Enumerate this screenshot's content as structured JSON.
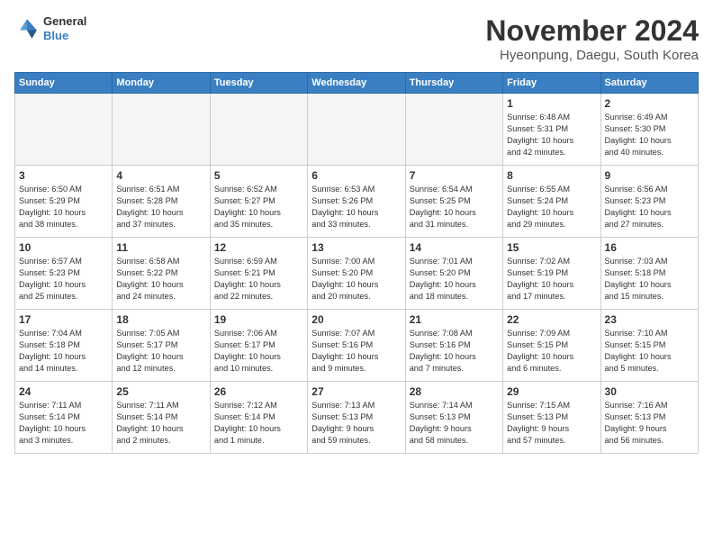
{
  "header": {
    "logo_line1": "General",
    "logo_line2": "Blue",
    "month_year": "November 2024",
    "location": "Hyeonpung, Daegu, South Korea"
  },
  "days_of_week": [
    "Sunday",
    "Monday",
    "Tuesday",
    "Wednesday",
    "Thursday",
    "Friday",
    "Saturday"
  ],
  "weeks": [
    [
      {
        "day": "",
        "info": "",
        "empty": true
      },
      {
        "day": "",
        "info": "",
        "empty": true
      },
      {
        "day": "",
        "info": "",
        "empty": true
      },
      {
        "day": "",
        "info": "",
        "empty": true
      },
      {
        "day": "",
        "info": "",
        "empty": true
      },
      {
        "day": "1",
        "info": "Sunrise: 6:48 AM\nSunset: 5:31 PM\nDaylight: 10 hours\nand 42 minutes."
      },
      {
        "day": "2",
        "info": "Sunrise: 6:49 AM\nSunset: 5:30 PM\nDaylight: 10 hours\nand 40 minutes."
      }
    ],
    [
      {
        "day": "3",
        "info": "Sunrise: 6:50 AM\nSunset: 5:29 PM\nDaylight: 10 hours\nand 38 minutes."
      },
      {
        "day": "4",
        "info": "Sunrise: 6:51 AM\nSunset: 5:28 PM\nDaylight: 10 hours\nand 37 minutes."
      },
      {
        "day": "5",
        "info": "Sunrise: 6:52 AM\nSunset: 5:27 PM\nDaylight: 10 hours\nand 35 minutes."
      },
      {
        "day": "6",
        "info": "Sunrise: 6:53 AM\nSunset: 5:26 PM\nDaylight: 10 hours\nand 33 minutes."
      },
      {
        "day": "7",
        "info": "Sunrise: 6:54 AM\nSunset: 5:25 PM\nDaylight: 10 hours\nand 31 minutes."
      },
      {
        "day": "8",
        "info": "Sunrise: 6:55 AM\nSunset: 5:24 PM\nDaylight: 10 hours\nand 29 minutes."
      },
      {
        "day": "9",
        "info": "Sunrise: 6:56 AM\nSunset: 5:23 PM\nDaylight: 10 hours\nand 27 minutes."
      }
    ],
    [
      {
        "day": "10",
        "info": "Sunrise: 6:57 AM\nSunset: 5:23 PM\nDaylight: 10 hours\nand 25 minutes."
      },
      {
        "day": "11",
        "info": "Sunrise: 6:58 AM\nSunset: 5:22 PM\nDaylight: 10 hours\nand 24 minutes."
      },
      {
        "day": "12",
        "info": "Sunrise: 6:59 AM\nSunset: 5:21 PM\nDaylight: 10 hours\nand 22 minutes."
      },
      {
        "day": "13",
        "info": "Sunrise: 7:00 AM\nSunset: 5:20 PM\nDaylight: 10 hours\nand 20 minutes."
      },
      {
        "day": "14",
        "info": "Sunrise: 7:01 AM\nSunset: 5:20 PM\nDaylight: 10 hours\nand 18 minutes."
      },
      {
        "day": "15",
        "info": "Sunrise: 7:02 AM\nSunset: 5:19 PM\nDaylight: 10 hours\nand 17 minutes."
      },
      {
        "day": "16",
        "info": "Sunrise: 7:03 AM\nSunset: 5:18 PM\nDaylight: 10 hours\nand 15 minutes."
      }
    ],
    [
      {
        "day": "17",
        "info": "Sunrise: 7:04 AM\nSunset: 5:18 PM\nDaylight: 10 hours\nand 14 minutes."
      },
      {
        "day": "18",
        "info": "Sunrise: 7:05 AM\nSunset: 5:17 PM\nDaylight: 10 hours\nand 12 minutes."
      },
      {
        "day": "19",
        "info": "Sunrise: 7:06 AM\nSunset: 5:17 PM\nDaylight: 10 hours\nand 10 minutes."
      },
      {
        "day": "20",
        "info": "Sunrise: 7:07 AM\nSunset: 5:16 PM\nDaylight: 10 hours\nand 9 minutes."
      },
      {
        "day": "21",
        "info": "Sunrise: 7:08 AM\nSunset: 5:16 PM\nDaylight: 10 hours\nand 7 minutes."
      },
      {
        "day": "22",
        "info": "Sunrise: 7:09 AM\nSunset: 5:15 PM\nDaylight: 10 hours\nand 6 minutes."
      },
      {
        "day": "23",
        "info": "Sunrise: 7:10 AM\nSunset: 5:15 PM\nDaylight: 10 hours\nand 5 minutes."
      }
    ],
    [
      {
        "day": "24",
        "info": "Sunrise: 7:11 AM\nSunset: 5:14 PM\nDaylight: 10 hours\nand 3 minutes."
      },
      {
        "day": "25",
        "info": "Sunrise: 7:11 AM\nSunset: 5:14 PM\nDaylight: 10 hours\nand 2 minutes."
      },
      {
        "day": "26",
        "info": "Sunrise: 7:12 AM\nSunset: 5:14 PM\nDaylight: 10 hours\nand 1 minute."
      },
      {
        "day": "27",
        "info": "Sunrise: 7:13 AM\nSunset: 5:13 PM\nDaylight: 9 hours\nand 59 minutes."
      },
      {
        "day": "28",
        "info": "Sunrise: 7:14 AM\nSunset: 5:13 PM\nDaylight: 9 hours\nand 58 minutes."
      },
      {
        "day": "29",
        "info": "Sunrise: 7:15 AM\nSunset: 5:13 PM\nDaylight: 9 hours\nand 57 minutes."
      },
      {
        "day": "30",
        "info": "Sunrise: 7:16 AM\nSunset: 5:13 PM\nDaylight: 9 hours\nand 56 minutes."
      }
    ]
  ]
}
